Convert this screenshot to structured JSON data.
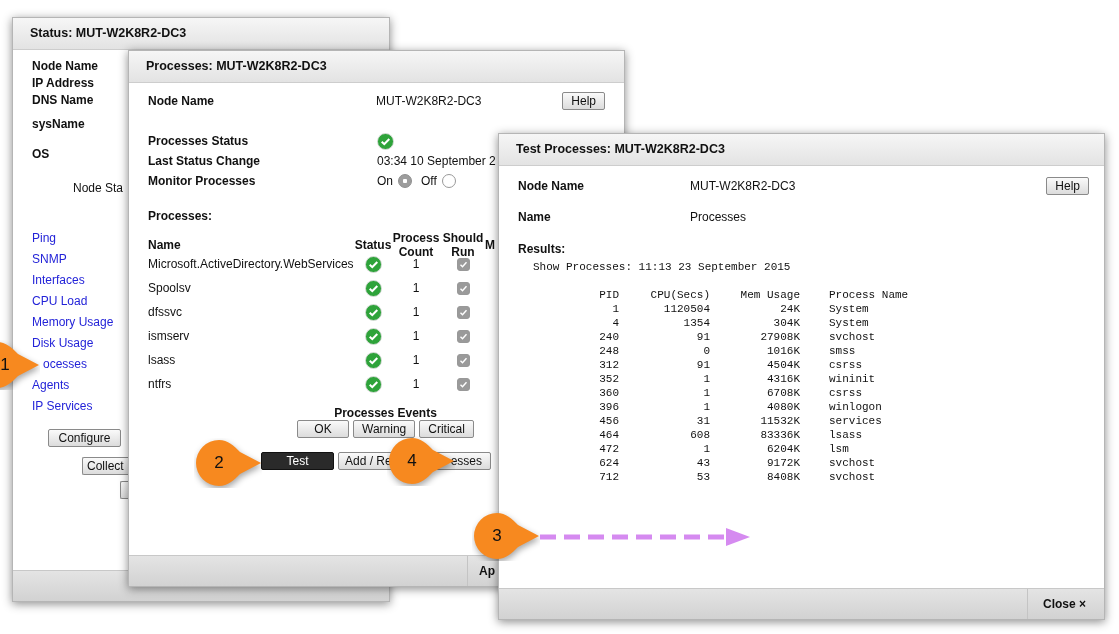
{
  "status_window": {
    "title": "Status: MUT-W2K8R2-DC3",
    "fields": [
      "Node Name",
      "IP Address",
      "DNS Name",
      "sysName",
      "OS"
    ],
    "node_status_label": "Node Sta",
    "links": [
      "Ping",
      "SNMP",
      "Interfaces",
      "CPU Load",
      "Memory Usage",
      "Disk Usage",
      "ocesses",
      "Agents",
      "IP Services"
    ],
    "buttons": [
      "Configure",
      "Collect"
    ]
  },
  "processes_window": {
    "title": "Processes: MUT-W2K8R2-DC3",
    "node_name_label": "Node Name",
    "node_name": "MUT-W2K8R2-DC3",
    "help_button": "Help",
    "status_label": "Processes Status",
    "healthy": true,
    "last_change_label": "Last Status Change",
    "last_change": "03:34 10 September 2",
    "monitor_label": "Monitor Processes",
    "monitor_options": [
      {
        "label": "On",
        "selected": true
      },
      {
        "label": "Off",
        "selected": false
      }
    ],
    "processes_heading": "Processes:",
    "columns": [
      "Name",
      "Status",
      "Process Count",
      "Should Run",
      "M"
    ],
    "rows": [
      {
        "name": "Microsoft.ActiveDirectory.WebServices",
        "healthy": true,
        "count": "1",
        "should_run": true
      },
      {
        "name": "Spoolsv",
        "healthy": true,
        "count": "1",
        "should_run": true
      },
      {
        "name": "dfssvc",
        "healthy": true,
        "count": "1",
        "should_run": true
      },
      {
        "name": "ismserv",
        "healthy": true,
        "count": "1",
        "should_run": true
      },
      {
        "name": "lsass",
        "healthy": true,
        "count": "1",
        "should_run": true
      },
      {
        "name": "ntfrs",
        "healthy": true,
        "count": "1",
        "should_run": true
      }
    ],
    "events_heading": "Processes Events",
    "event_buttons": [
      "OK",
      "Warning",
      "Critical"
    ],
    "test_button": "Test",
    "add_button_start": "Add / Re",
    "add_button_end": "esses",
    "footer_button": "Ap"
  },
  "test_window": {
    "title": "Test Processes: MUT-W2K8R2-DC3",
    "node_name_label": "Node Name",
    "node_name": "MUT-W2K8R2-DC3",
    "help_button": "Help",
    "name_label": "Name",
    "name_value": "Processes",
    "results_label": "Results:",
    "results_line": "Show Processes: 11:13 23 September 2015",
    "columns": [
      "PID",
      "CPU(Secs)",
      "Mem Usage",
      "Process Name"
    ],
    "rows": [
      [
        "1",
        "1120504",
        "24K",
        "System"
      ],
      [
        "4",
        "1354",
        "304K",
        "System"
      ],
      [
        "240",
        "91",
        "27908K",
        "svchost"
      ],
      [
        "248",
        "0",
        "1016K",
        "smss"
      ],
      [
        "312",
        "91",
        "4504K",
        "csrss"
      ],
      [
        "352",
        "1",
        "4316K",
        "wininit"
      ],
      [
        "360",
        "1",
        "6708K",
        "csrss"
      ],
      [
        "396",
        "1",
        "4080K",
        "winlogon"
      ],
      [
        "456",
        "31",
        "11532K",
        "services"
      ],
      [
        "464",
        "608",
        "83336K",
        "lsass"
      ],
      [
        "472",
        "1",
        "6204K",
        "lsm"
      ],
      [
        "624",
        "43",
        "9172K",
        "svchost"
      ],
      [
        "712",
        "53",
        "8408K",
        "svchost"
      ]
    ],
    "close_button": "Close ×"
  },
  "callouts": [
    "1",
    "2",
    "4",
    "3"
  ]
}
